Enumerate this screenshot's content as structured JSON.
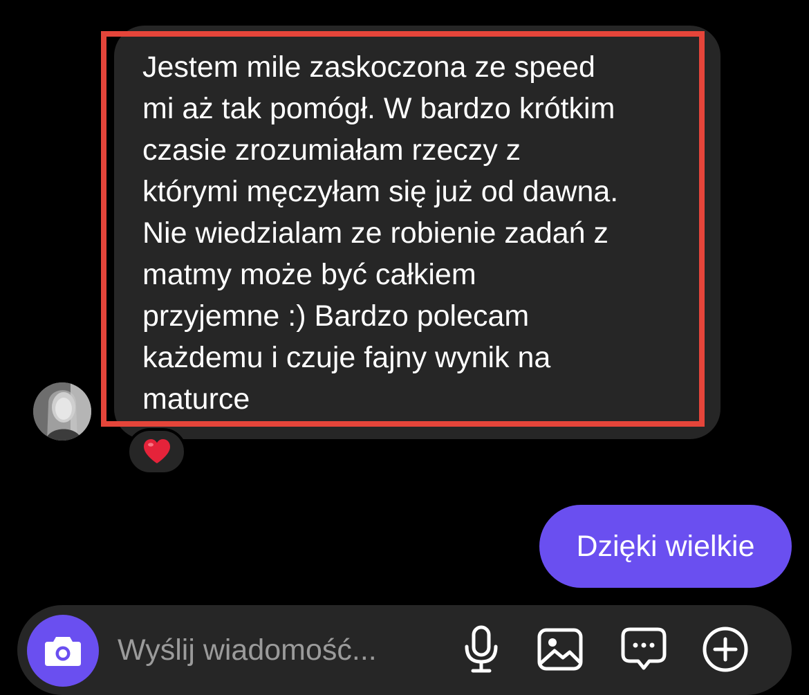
{
  "conversation": {
    "incoming": {
      "lines": [
        "Jestem mile zaskoczona ze speed",
        "mi aż tak pomógł. W bardzo krótkim",
        "czasie zrozumiałam rzeczy z",
        "którymi męczyłam się już od dawna.",
        "Nie wiedzialam ze robienie zadań z",
        "matmy może być całkiem",
        "przyjemne :) Bardzo polecam",
        "każdemu i czuje fajny wynik na",
        "maturce"
      ],
      "reaction": "❤️"
    },
    "outgoing": {
      "text": "Dzięki wielkie"
    }
  },
  "composer": {
    "placeholder": "Wyślij wiadomość...",
    "icons": [
      "camera-icon",
      "microphone-icon",
      "image-icon",
      "sticker-icon",
      "plus-icon"
    ]
  },
  "colors": {
    "background": "#000000",
    "incoming_bubble": "#262626",
    "outgoing_bubble": "#6a4ff0",
    "highlight": "#e5453a",
    "placeholder": "#9b9b9b"
  }
}
